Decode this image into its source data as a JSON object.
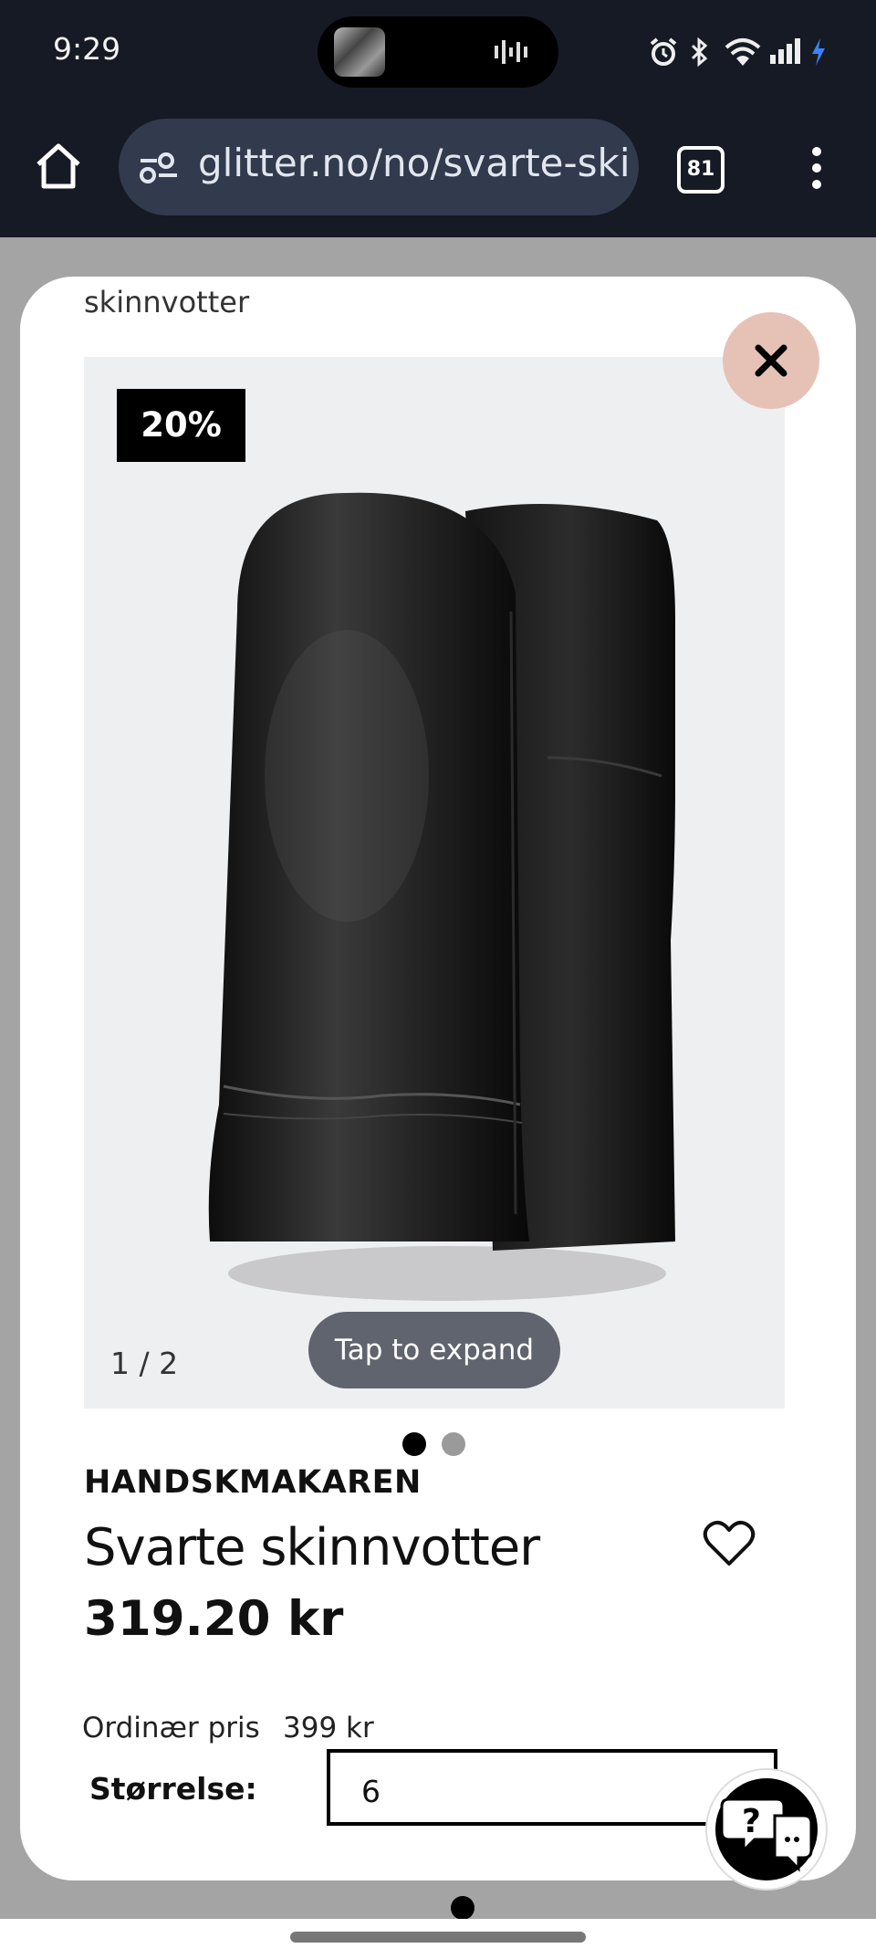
{
  "status_bar": {
    "time": "9:29"
  },
  "browser": {
    "url": "glitter.no/no/svarte-skin",
    "tab_count": "81"
  },
  "modal": {
    "breadcrumb_tail": "skinnvotter",
    "discount_badge": "20%",
    "image_counter": "1 / 2",
    "expand_label": "Tap to expand",
    "brand": "HANDSKMAKAREN",
    "product_title": "Svarte skinnvotter",
    "price": "319.20 kr",
    "ordinary_price_label": "Ordinær pris",
    "ordinary_price_value": "399 kr",
    "size_label": "Størrelse:",
    "size_value": "6"
  },
  "colors": {
    "close_button_bg": "#e6c2b6",
    "expand_button_bg": "#5f646e",
    "status_bar_bg": "#161a24"
  },
  "icons": [
    "home-icon",
    "site-settings-icon",
    "more-vert-icon",
    "close-icon",
    "heart-icon",
    "chat-help-icon",
    "alarm-icon",
    "bluetooth-icon",
    "wifi-icon",
    "signal-icon",
    "battery-icon",
    "audio-wave-icon"
  ]
}
